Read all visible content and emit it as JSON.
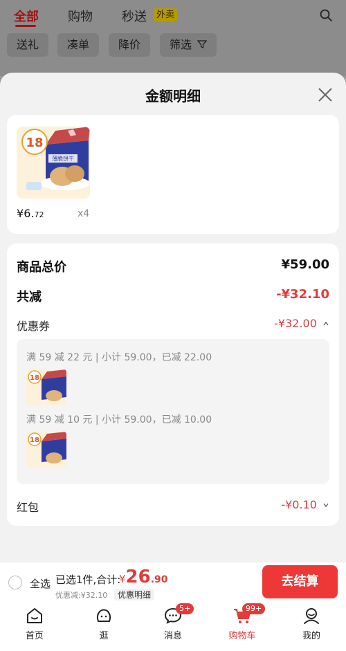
{
  "top_tabs": [
    {
      "label": "全部"
    },
    {
      "label": "购物"
    },
    {
      "label": "秒送"
    }
  ],
  "waimai_badge": "外卖",
  "filter_chips": [
    "送礼",
    "凑单",
    "降价",
    "筛选"
  ],
  "sheet": {
    "title": "金额明细"
  },
  "product": {
    "price_currency": "¥",
    "price_int": "6.",
    "price_dec": "72",
    "qty": "x4",
    "box_badge": "18",
    "box_text": "薄脆饼干"
  },
  "details": {
    "goods_total_label": "商品总价",
    "goods_total_value": "¥59.00",
    "total_reduce_label": "共减",
    "total_reduce_value": "-¥32.10",
    "coupon_label": "优惠券",
    "coupon_value": "-¥32.00",
    "coupon_lines": [
      "满 59 减 22 元 | 小计 59.00，已减 22.00",
      "满 59 减 10 元 | 小计 59.00，已减 10.00"
    ],
    "redpacket_label": "红包",
    "redpacket_value": "-¥0.10"
  },
  "checkout": {
    "select_all": "全选",
    "selected_text": "已选1件,合计:",
    "total_currency": "¥",
    "total_int": "26",
    "total_dec": ".90",
    "discount_text": "优惠减:¥32.10",
    "detail_link": "优惠明细",
    "button": "去结算"
  },
  "bottom_nav": [
    {
      "label": "首页",
      "icon": "home-icon"
    },
    {
      "label": "逛",
      "icon": "explore-icon"
    },
    {
      "label": "消息",
      "icon": "message-icon",
      "badge": "5+"
    },
    {
      "label": "购物车",
      "icon": "cart-icon",
      "badge": "99+",
      "active": true
    },
    {
      "label": "我的",
      "icon": "profile-icon"
    }
  ],
  "colors": {
    "accent_red": "#e33b3b",
    "tab_active": "#a21313"
  }
}
